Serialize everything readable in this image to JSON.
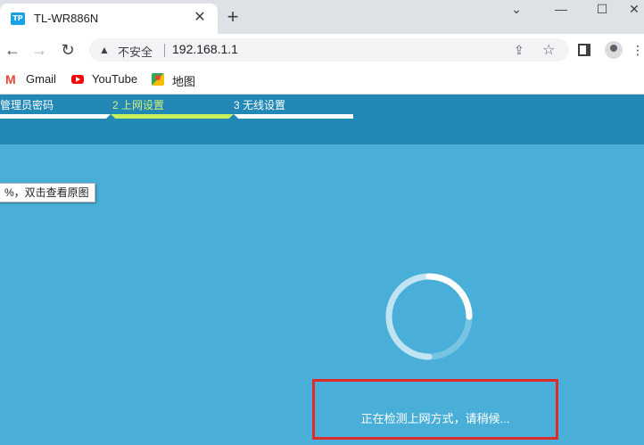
{
  "browser": {
    "tab_title": "TL-WR886N",
    "favicon_text": "TP",
    "window_controls": {
      "chevron": "⌄",
      "minimize": "—",
      "maximize": "☐",
      "close": "✕"
    },
    "tab_close": "✕",
    "new_tab": "+",
    "nav": {
      "back": "←",
      "forward": "→",
      "reload": "↻"
    },
    "omnibox": {
      "security_label": "不安全",
      "url": "192.168.1.1"
    },
    "icons": [
      "back-arrow-icon",
      "forward-arrow-icon",
      "reload-icon",
      "warning-triangle-icon",
      "share-icon",
      "star-icon",
      "side-panel-icon",
      "profile-icon",
      "kebab-menu-icon"
    ],
    "bookmarks": [
      {
        "label": "Gmail",
        "icon": "gmail-icon"
      },
      {
        "label": "YouTube",
        "icon": "youtube-icon"
      },
      {
        "label": "地图",
        "icon": "maps-icon"
      }
    ]
  },
  "router": {
    "steps": [
      {
        "label": "管理员密码"
      },
      {
        "label": "2 上网设置"
      },
      {
        "label": "3 无线设置"
      }
    ],
    "active_step": 2,
    "tooltip": "%，双击查看原图",
    "status_text": "正在检测上网方式，请稍候...",
    "colors": {
      "page_bg": "#4aafd8",
      "header_bg": "#2288b6",
      "active_step": "#c6f05a",
      "highlight_box": "#e02b2b"
    }
  }
}
